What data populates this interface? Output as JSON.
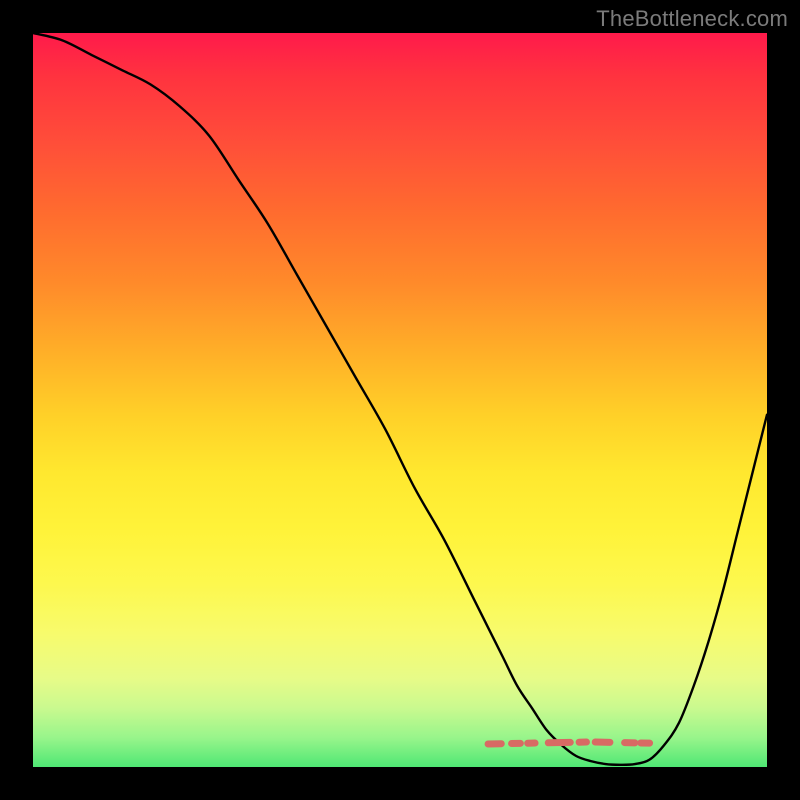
{
  "watermark": "TheBottleneck.com",
  "colors": {
    "bg": "#000000",
    "curve": "#000000",
    "dash": "#d86a64",
    "gradient_top": "#ff1a4b",
    "gradient_bottom": "#4fe774"
  },
  "chart_data": {
    "type": "line",
    "title": "",
    "xlabel": "",
    "ylabel": "",
    "xlim": [
      0,
      100
    ],
    "ylim": [
      0,
      100
    ],
    "grid": false,
    "series": [
      {
        "name": "bottleneck-curve",
        "x": [
          0,
          4,
          8,
          12,
          16,
          20,
          24,
          28,
          32,
          36,
          40,
          44,
          48,
          52,
          56,
          60,
          62,
          64,
          66,
          68,
          70,
          72,
          74,
          76,
          78,
          80,
          82,
          84,
          86,
          88,
          90,
          92,
          94,
          96,
          98,
          100
        ],
        "values": [
          100,
          99,
          97,
          95,
          93,
          90,
          86,
          80,
          74,
          67,
          60,
          53,
          46,
          38,
          31,
          23,
          19,
          15,
          11,
          8,
          5,
          3,
          1.5,
          0.8,
          0.4,
          0.3,
          0.4,
          1,
          3,
          6,
          11,
          17,
          24,
          32,
          40,
          48
        ]
      }
    ],
    "highlight_dash": {
      "name": "optimal-range",
      "y_level": 4.5,
      "x_start": 62,
      "x_end": 84,
      "color": "#d86a64"
    }
  }
}
